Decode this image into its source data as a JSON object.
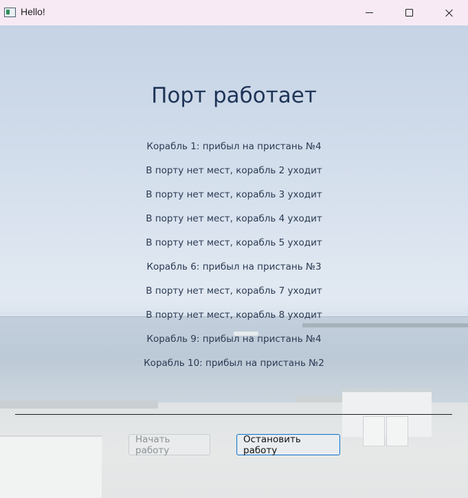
{
  "window": {
    "title": "Hello!",
    "controls": [
      "minimize-icon",
      "maximize-icon",
      "close-icon"
    ]
  },
  "main": {
    "heading": "Порт работает",
    "messages": [
      "Корабль 1: прибыл на пристань №4",
      "В порту нет мест, корабль 2 уходит",
      "В порту нет мест, корабль 3 уходит",
      "В порту нет мест, корабль 4 уходит",
      "В порту нет мест, корабль 5 уходит",
      "Корабль 6: прибыл на пристань №3",
      "В порту нет мест, корабль 7 уходит",
      "В порту нет мест, корабль 8 уходит",
      "Корабль 9: прибыл на пристань №4",
      "Корабль 10: прибыл на пристань №2"
    ]
  },
  "buttons": {
    "start_label": "Начать работу",
    "start_enabled": false,
    "stop_label": "Остановить работу",
    "stop_enabled": true
  },
  "colors": {
    "titlebar_bg": "#f7eaf4",
    "heading_text": "#1f3557",
    "focus_border": "#1a74c4"
  }
}
